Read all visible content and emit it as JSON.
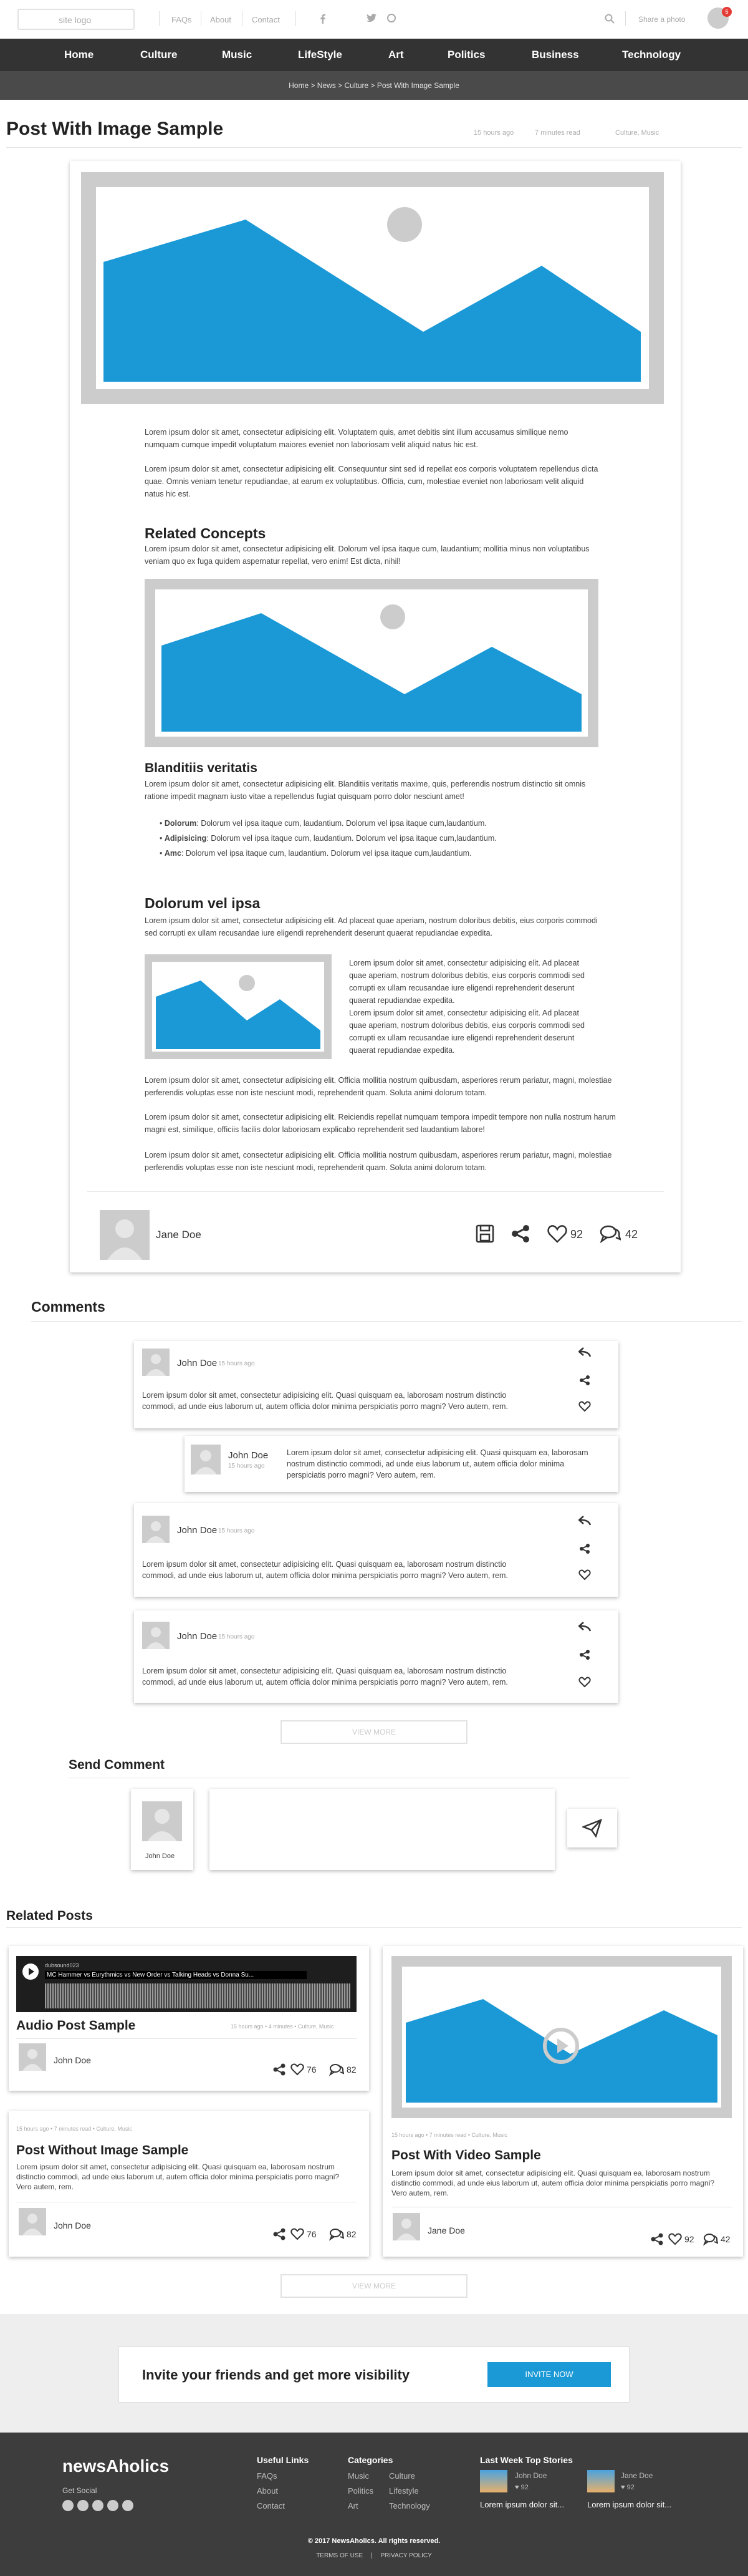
{
  "header": {
    "logo_text": "site logo",
    "links": [
      "FAQs",
      "About",
      "Contact"
    ],
    "share_label": "Share a photo",
    "notification_count": "5",
    "social_icons": [
      "facebook-icon",
      "twitter-icon",
      "pinterest-icon"
    ]
  },
  "nav": [
    "Home",
    "Culture",
    "Music",
    "LifeStyle",
    "Art",
    "Politics",
    "Business",
    "Technology"
  ],
  "breadcrumb": "Home  >  News  >  Culture  >  Post With Image Sample",
  "post": {
    "title": "Post With Image Sample",
    "time": "15 hours ago",
    "read": "7 minutes read",
    "categories": "Culture, Music",
    "intro_1": "Lorem ipsum dolor sit amet, consectetur adipisicing elit. Voluptatem quis, amet debitis sint illum accusamus similique nemo numquam cumque impedit voluptatum maiores eveniet non laboriosam velit aliquid natus hic est.",
    "intro_2": "Lorem ipsum dolor sit amet, consectetur adipisicing elit. Consequuntur sint sed id repellat eos corporis voluptatem repellendus dicta quae. Omnis veniam tenetur repudiandae, at earum ex voluptatibus. Officia, cum, molestiae eveniet non laboriosam velit aliquid natus hic est.",
    "h_related": "Related Concepts",
    "related_p": "Lorem ipsum dolor sit amet, consectetur adipisicing elit. Dolorum vel ipsa itaque cum, laudantium; mollitia minus non voluptatibus veniam quo ex fuga quidem aspernatur repellat, vero enim! Est dicta, nihil!",
    "h_blanditiis": "Blanditiis veritatis",
    "blanditiis_p": "Lorem ipsum dolor sit amet, consectetur adipisicing elit. Blanditiis veritatis maxime, quis, perferendis nostrum distinctio sit omnis ratione impedit magnam iusto vitae a repellendus fugiat quisquam porro dolor nesciunt amet!",
    "list": [
      {
        "term": "Dolorum",
        "text": "Dolorum vel ipsa itaque cum, laudantium. Dolorum vel ipsa itaque cum,laudantium."
      },
      {
        "term": "Adipisicing",
        "text": "Dolorum vel ipsa itaque cum, laudantium. Dolorum vel ipsa itaque cum,laudantium."
      },
      {
        "term": "Amc",
        "text": "Dolorum vel ipsa itaque cum, laudantium. Dolorum vel ipsa itaque cum,laudantium."
      }
    ],
    "h_dolorum": "Dolorum vel ipsa",
    "dolorum_p": "Lorem ipsum dolor sit amet, consectetur adipisicing elit. Ad placeat quae aperiam, nostrum doloribus debitis, eius corporis commodi sed corrupti ex ullam recusandae iure eligendi reprehenderit deserunt quaerat repudiandae expedita.",
    "side_p1": "Lorem ipsum dolor sit amet, consectetur adipisicing elit. Ad placeat quae aperiam, nostrum doloribus debitis, eius corporis commodi sed corrupti ex ullam recusandae iure eligendi reprehenderit deserunt quaerat repudiandae expedita.",
    "side_p2": "Lorem ipsum dolor sit amet, consectetur adipisicing elit. Ad placeat quae aperiam, nostrum doloribus debitis, eius corporis commodi sed corrupti ex ullam recusandae iure eligendi reprehenderit deserunt quaerat repudiandae expedita.",
    "end_1": "Lorem ipsum dolor sit amet, consectetur adipisicing elit. Officia mollitia nostrum quibusdam, asperiores rerum pariatur, magni, molestiae perferendis voluptas esse non iste nesciunt modi, reprehenderit quam. Soluta animi dolorum totam.",
    "end_2": "Lorem ipsum dolor sit amet, consectetur adipisicing elit. Reiciendis repellat numquam tempora impedit tempore non nulla nostrum harum magni est, similique, officiis facilis dolor laboriosam explicabo reprehenderit sed laudantium labore!",
    "end_3": "Lorem ipsum dolor sit amet, consectetur adipisicing elit. Officia mollitia nostrum quibusdam, asperiores rerum pariatur, magni, molestiae perferendis voluptas esse non iste nesciunt modi, reprehenderit quam. Soluta animi dolorum totam.",
    "author": "Jane Doe",
    "likes": "92",
    "comments": "42"
  },
  "comments": {
    "title": "Comments",
    "items": [
      {
        "name": "John Doe",
        "time": "15 hours ago",
        "text": "Lorem ipsum dolor sit amet, consectetur adipisicing elit. Quasi quisquam ea, laborosam nostrum distinctio commodi, ad unde eius laborum ut, autem officia dolor minima perspiciatis porro magni? Vero autem, rem."
      },
      {
        "name": "John Doe",
        "time": "15 hours ago",
        "text": "Lorem ipsum dolor sit amet, consectetur adipisicing elit. Quasi quisquam ea, laborosam nostrum distinctio commodi, ad unde eius laborum ut, autem officia dolor minima perspiciatis porro magni? Vero autem, rem."
      },
      {
        "name": "John Doe",
        "time": "15 hours ago",
        "text": "Lorem ipsum dolor sit amet, consectetur adipisicing elit. Quasi quisquam ea, laborosam nostrum distinctio commodi, ad unde eius laborum ut, autem officia dolor minima perspiciatis porro magni? Vero autem, rem."
      },
      {
        "name": "John Doe",
        "time": "15 hours ago",
        "text": "Lorem ipsum dolor sit amet, consectetur adipisicing elit. Quasi quisquam ea, laborosam nostrum distinctio commodi, ad unde eius laborum ut, autem officia dolor minima perspiciatis porro magni? Vero autem, rem."
      }
    ],
    "view_more": "VIEW MORE"
  },
  "send": {
    "title": "Send Comment",
    "user": "John Doe"
  },
  "related": {
    "title": "Related Posts",
    "audio": {
      "track_user": "dubsound023",
      "track_title": "MC Hammer vs Eurythmics vs New Order vs Talking Heads vs Donna Su...",
      "title": "Audio Post Sample",
      "meta": "15 hours ago  •  4 minutes  •  Culture, Music",
      "author": "John Doe",
      "likes": "76",
      "comments": "82"
    },
    "noimage": {
      "meta": "15 hours ago  •  7 minutes read  •  Culture, Music",
      "title": "Post Without Image Sample",
      "text": "Lorem ipsum dolor sit amet, consectetur adipisicing elit. Quasi quisquam ea, laborosam nostrum distinctio commodi, ad unde eius laborum ut, autem officia dolor minima perspiciatis porro magni? Vero autem, rem.",
      "author": "John Doe",
      "likes": "76",
      "comments": "82"
    },
    "video": {
      "meta": "15 hours ago  •  7 minutes read  •  Culture, Music",
      "title": "Post With Video Sample",
      "text": "Lorem ipsum dolor sit amet, consectetur adipisicing elit. Quasi quisquam ea, laborosam nostrum distinctio commodi, ad unde eius laborum ut, autem officia dolor minima perspiciatis porro magni? Vero autem, rem.",
      "author": "Jane Doe",
      "likes": "92",
      "comments": "42"
    },
    "view_more": "VIEW MORE"
  },
  "invite": {
    "text": "Invite your friends and get more visibility",
    "button": "INVITE NOW"
  },
  "footer": {
    "brand": "newsAholics",
    "social_label": "Get Social",
    "useful_title": "Useful Links",
    "useful": [
      "FAQs",
      "About",
      "Contact"
    ],
    "cat_title": "Categories",
    "cat_col1": [
      "Music",
      "Politics",
      "Art"
    ],
    "cat_col2": [
      "Culture",
      "Lifestyle",
      "Technology"
    ],
    "top_title": "Last Week Top Stories",
    "stories": [
      {
        "author": "John Doe",
        "likes": "92",
        "text": "Lorem ipsum dolor sit..."
      },
      {
        "author": "Jane Doe",
        "likes": "92",
        "text": "Lorem ipsum dolor sit..."
      }
    ],
    "copyright": "© 2017 NewsAholics. All rights reserved.",
    "terms": "TERMS OF USE",
    "privacy": "PRIVACY POLICY"
  },
  "colors": {
    "accent": "#1a99d6",
    "nav_bg": "#333333",
    "placeholder_frame": "#cccccc",
    "notification": "#e53935"
  }
}
